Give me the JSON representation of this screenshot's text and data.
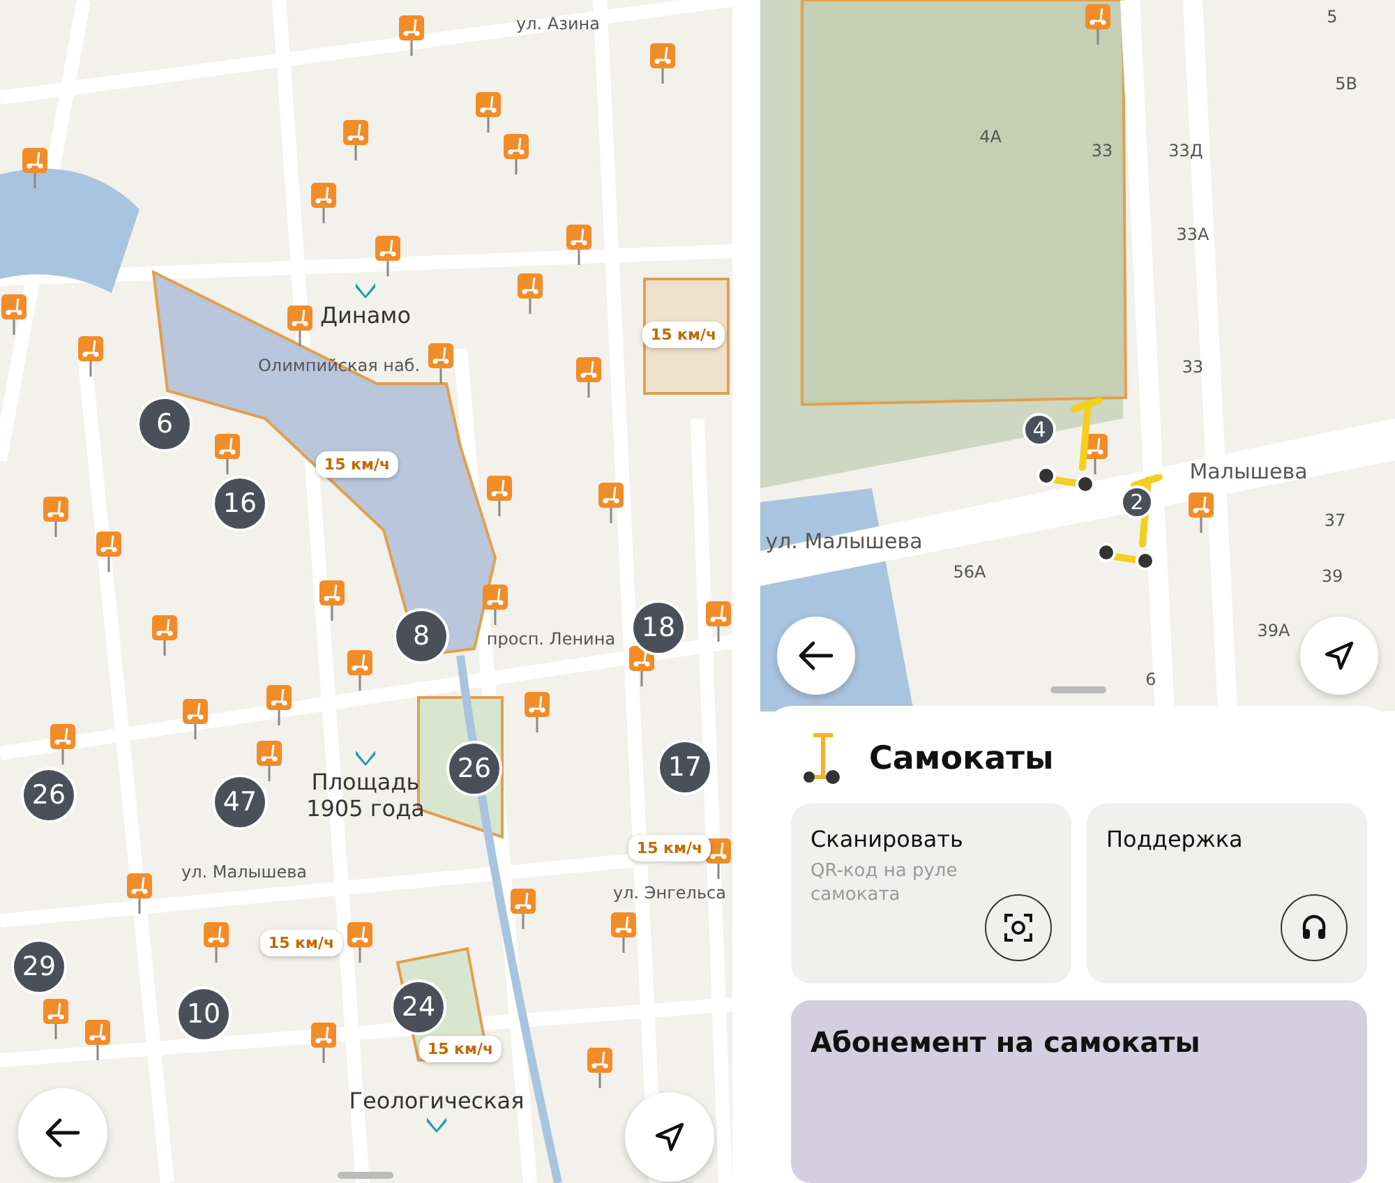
{
  "left_map": {
    "map_labels": [
      "ул. Азина",
      "просп. Ленина",
      "ул. Малышева",
      "ул. Энгельса",
      "Олимпийская наб."
    ],
    "stations": [
      {
        "name": "Динамо"
      },
      {
        "name": "Площадь 1905 года"
      },
      {
        "name": "Геологическая"
      }
    ],
    "speed_limits": [
      "15 км/ч",
      "15 км/ч",
      "15 км/ч",
      "15 км/ч",
      "15 км/ч"
    ],
    "clusters": [
      "6",
      "16",
      "8",
      "18",
      "26",
      "17",
      "26",
      "47",
      "29",
      "10",
      "24"
    ]
  },
  "right_map": {
    "map_labels": [
      "ул. Малышева",
      "Малышева",
      "4А",
      "33",
      "33Д",
      "33А",
      "33",
      "56А",
      "37",
      "39",
      "39А",
      "6",
      "5",
      "5В"
    ],
    "clusters": [
      "4",
      "2"
    ]
  },
  "sheet": {
    "title": "Самокаты",
    "actions": [
      {
        "kind": "scan",
        "title": "Сканировать",
        "subtitle": "QR-код на руле самоката"
      },
      {
        "kind": "support",
        "title": "Поддержка"
      }
    ],
    "promo": {
      "title": "Абонемент на самокаты"
    }
  }
}
